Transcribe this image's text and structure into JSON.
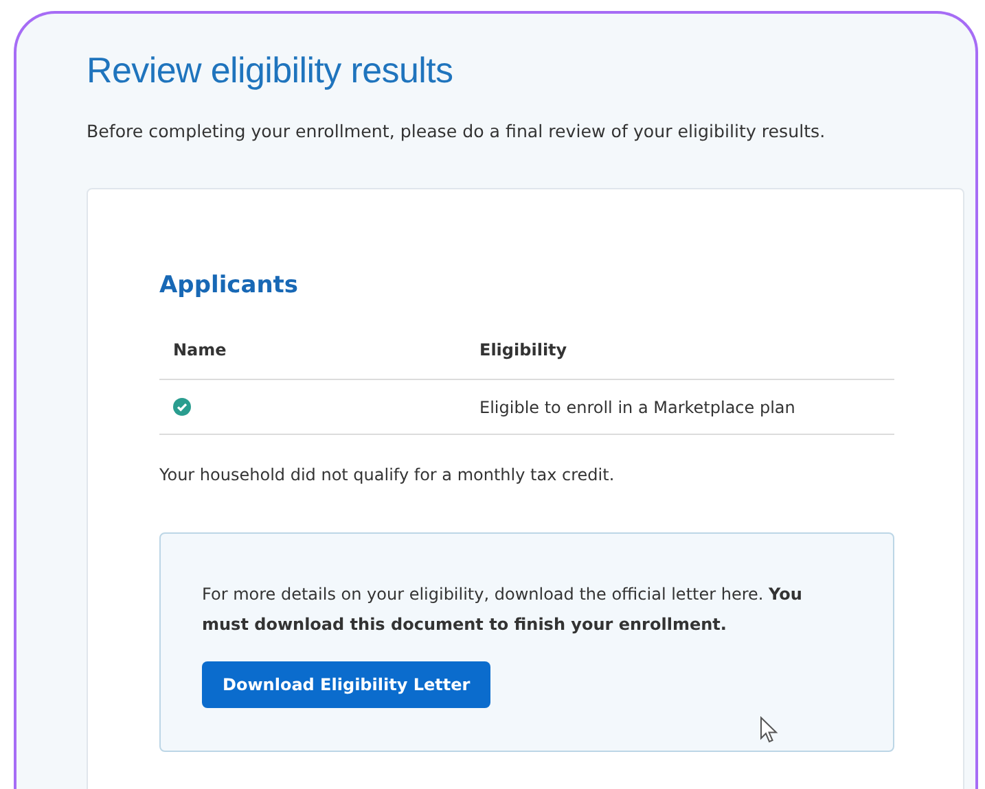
{
  "page": {
    "title": "Review eligibility results",
    "intro": "Before completing your enrollment, please do a final review of your eligibility results."
  },
  "applicants": {
    "heading": "Applicants",
    "columns": [
      "Name",
      "Eligibility"
    ],
    "rows": [
      {
        "eligibility": "Eligible to enroll in a Marketplace plan"
      }
    ],
    "note": "Your household did not qualify for a monthly tax credit."
  },
  "letter_box": {
    "text": "For more details on your eligibility, download the official letter here. **You must download this document to finish your enrollment.**",
    "button": "Download Eligibility Letter"
  }
}
